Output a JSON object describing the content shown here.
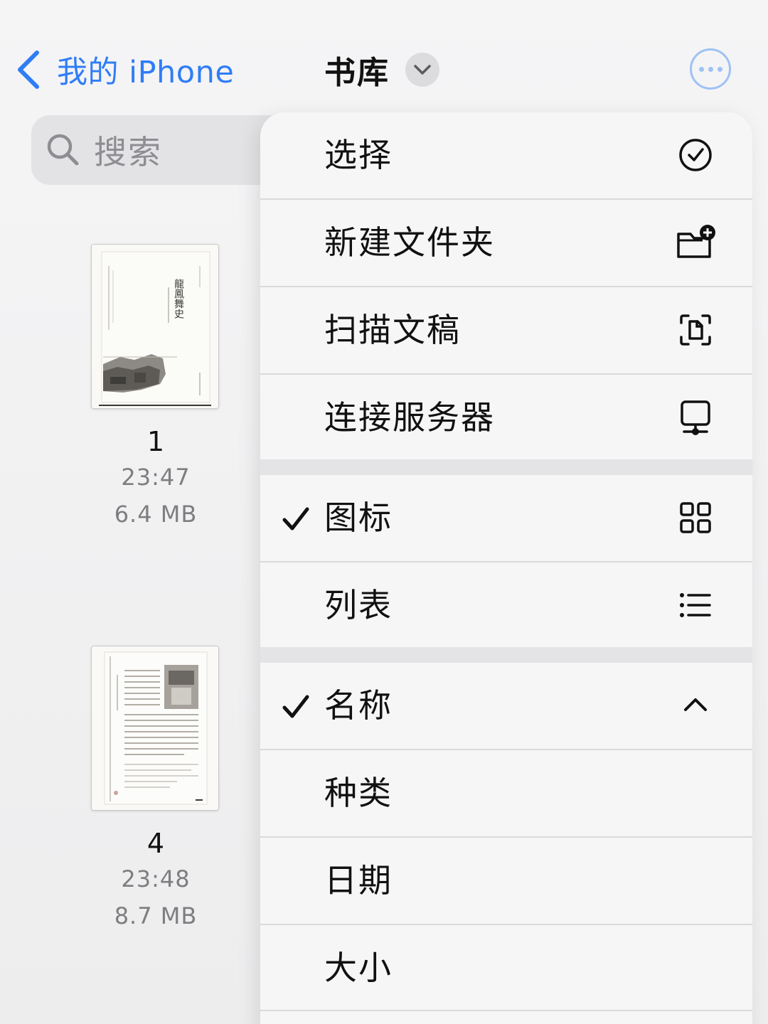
{
  "nav": {
    "back_label": "我的 iPhone",
    "title": "书库"
  },
  "search": {
    "placeholder": "搜索"
  },
  "files": [
    {
      "name": "1",
      "time": "23:47",
      "size": "6.4 MB",
      "thumb_caption": "龍鳳舞史"
    },
    {
      "name": "4",
      "time": "23:48",
      "size": "8.7 MB"
    }
  ],
  "menu": {
    "select": "选择",
    "new_folder": "新建文件夹",
    "scan": "扫描文稿",
    "connect_server": "连接服务器",
    "view_icons": "图标",
    "view_list": "列表",
    "sort_name": "名称",
    "sort_kind": "种类",
    "sort_date": "日期",
    "sort_size": "大小"
  },
  "state": {
    "view_mode": "图标",
    "sort_by": "名称",
    "sort_direction": "ascending"
  },
  "colors": {
    "accent": "#2f7df6",
    "accent_light": "#9fc1f4",
    "text": "#111111",
    "secondary": "#7e7e82"
  }
}
